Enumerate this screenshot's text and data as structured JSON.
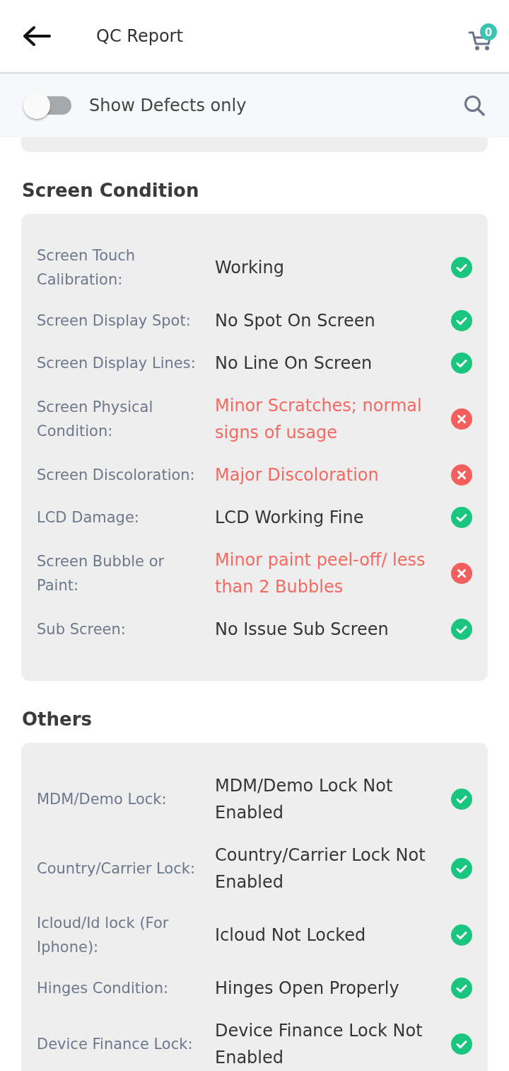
{
  "header": {
    "title": "QC Report",
    "cart_count": "0"
  },
  "filter": {
    "label": "Show Defects only",
    "on": false
  },
  "sections": [
    {
      "title": "Screen Condition",
      "items": [
        {
          "label": "Screen Touch Calibration:",
          "value": "Working",
          "defect": false
        },
        {
          "label": "Screen Display Spot:",
          "value": "No Spot On Screen",
          "defect": false
        },
        {
          "label": "Screen Display Lines:",
          "value": "No Line On Screen",
          "defect": false
        },
        {
          "label": "Screen Physical Condition:",
          "value": "Minor Scratches; normal signs of usage",
          "defect": true
        },
        {
          "label": "Screen Discoloration:",
          "value": "Major Discoloration",
          "defect": true
        },
        {
          "label": "LCD Damage:",
          "value": "LCD Working Fine",
          "defect": false
        },
        {
          "label": "Screen Bubble or Paint:",
          "value": "Minor paint peel-off/ less than 2 Bubbles",
          "defect": true
        },
        {
          "label": "Sub Screen:",
          "value": "No Issue Sub Screen",
          "defect": false
        }
      ]
    },
    {
      "title": "Others",
      "items": [
        {
          "label": "MDM/Demo Lock:",
          "value": "MDM/Demo Lock Not Enabled",
          "defect": false
        },
        {
          "label": "Country/Carrier Lock:",
          "value": "Country/Carrier Lock Not Enabled",
          "defect": false
        },
        {
          "label": "Icloud/Id lock (For Iphone):",
          "value": "Icloud Not Locked",
          "defect": false
        },
        {
          "label": "Hinges Condition:",
          "value": "Hinges Open Properly",
          "defect": false
        },
        {
          "label": "Device Finance Lock:",
          "value": "Device Finance Lock Not Enabled",
          "defect": false
        }
      ]
    }
  ]
}
